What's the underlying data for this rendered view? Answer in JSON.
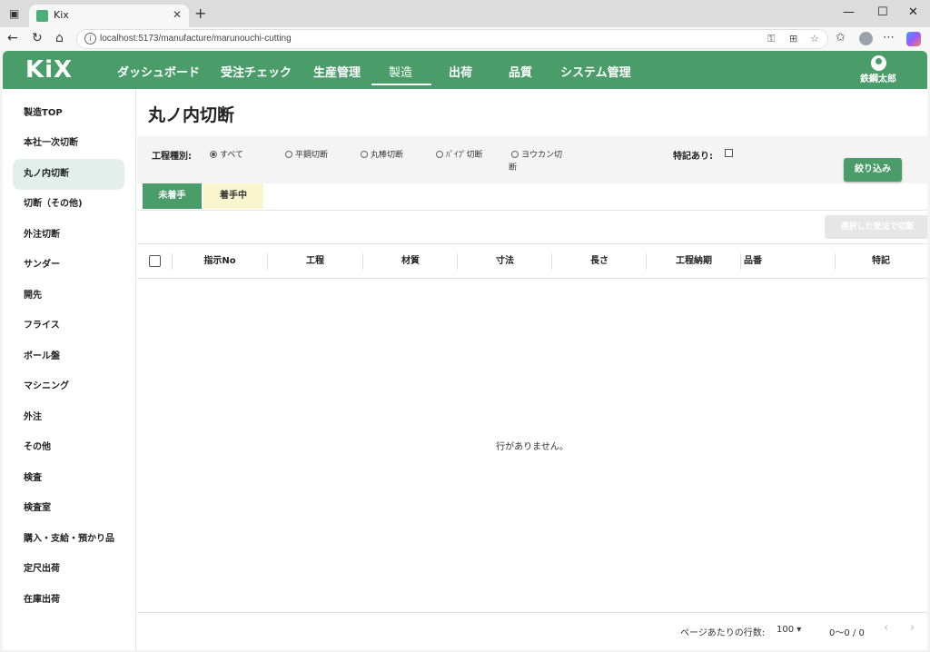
{
  "browser": {
    "tab_title": "Kix",
    "url": "localhost:5173/manufacture/marunouchi-cutting",
    "new_tab": "+",
    "tab_close": "✕",
    "win_min": "—",
    "win_max": "☐",
    "win_close": "✕"
  },
  "app": {
    "logo": "KiX",
    "nav": [
      "ダッシュボード",
      "受注チェック",
      "生産管理",
      "製造",
      "出荷",
      "品質",
      "システム管理"
    ],
    "active_nav_index": 3,
    "user_name": "鉄鋼太郎",
    "accent_color": "#4a9d68"
  },
  "sidebar": {
    "items": [
      "製造TOP",
      "本社一次切断",
      "丸ノ内切断",
      "切断（その他)",
      "外注切断",
      "サンダー",
      "開先",
      "フライス",
      "ボール盤",
      "マシニング",
      "外注",
      "その他",
      "検査",
      "検査室",
      "購入・支給・預かり品",
      "定尺出荷",
      "在庫出荷"
    ],
    "active_index": 2
  },
  "main": {
    "title": "丸ノ内切断",
    "filter": {
      "process_label": "工程種別:",
      "radios": [
        "すべて",
        "平鋼切断",
        "丸棒切断",
        "ﾊﾟｲﾌﾟ切断",
        "ヨウカン切",
        "断"
      ],
      "selected_index": 0,
      "note_label": "特記あり:",
      "apply_button": "絞り込み"
    },
    "tabs": {
      "not_started": "未着手",
      "in_progress": "着手中"
    },
    "bulk_button": "選択した受注で切断",
    "columns": [
      "指示No",
      "工程",
      "材質",
      "寸法",
      "長さ",
      "工程納期",
      "品番",
      "特記"
    ],
    "empty_message": "行がありません。",
    "pager": {
      "rows_label": "ページあたりの行数:",
      "rows_value": "100",
      "range": "0〜0 / 0",
      "prev": "‹",
      "next": "›"
    }
  }
}
